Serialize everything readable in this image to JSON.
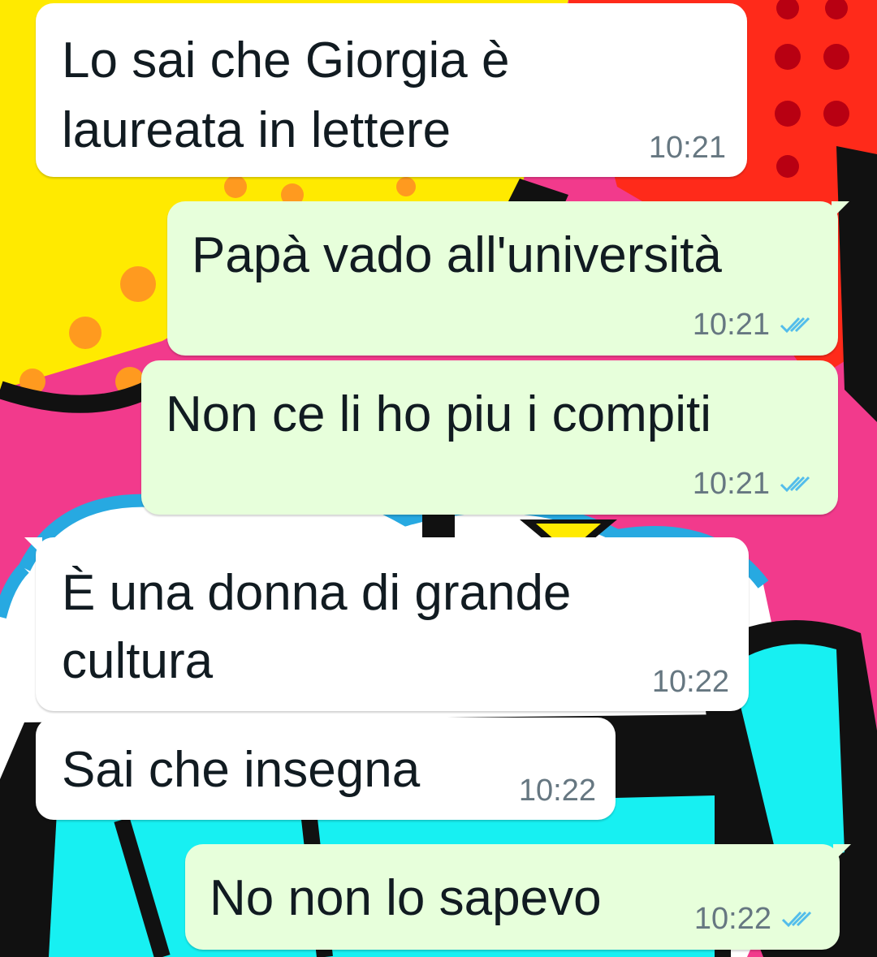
{
  "chat": {
    "messages": [
      {
        "direction": "incoming",
        "lines": [
          "Lo sai che Giorgia è",
          "laureata in lettere"
        ],
        "time": "10:21"
      },
      {
        "direction": "outgoing",
        "lines": [
          "Papà vado all'università"
        ],
        "time": "10:21",
        "status": "read",
        "status_icon": "double-check-icon",
        "status_color": "#53bdeb"
      },
      {
        "direction": "outgoing",
        "lines": [
          "Non ce li ho piu i compiti"
        ],
        "time": "10:21",
        "status": "read",
        "status_icon": "double-check-icon",
        "status_color": "#53bdeb"
      },
      {
        "direction": "incoming",
        "lines": [
          "È una donna di grande",
          "cultura"
        ],
        "time": "10:22"
      },
      {
        "direction": "incoming",
        "lines": [
          "Sai che insegna"
        ],
        "time": "10:22"
      },
      {
        "direction": "outgoing",
        "lines": [
          "No non lo sapevo"
        ],
        "time": "10:22",
        "status": "read",
        "status_icon": "double-check-icon",
        "status_color": "#53bdeb"
      }
    ]
  },
  "colors": {
    "incoming_bubble": "#ffffff",
    "outgoing_bubble": "#e7ffdb",
    "text": "#111b21",
    "meta": "#667781",
    "read_ticks": "#53bdeb"
  }
}
